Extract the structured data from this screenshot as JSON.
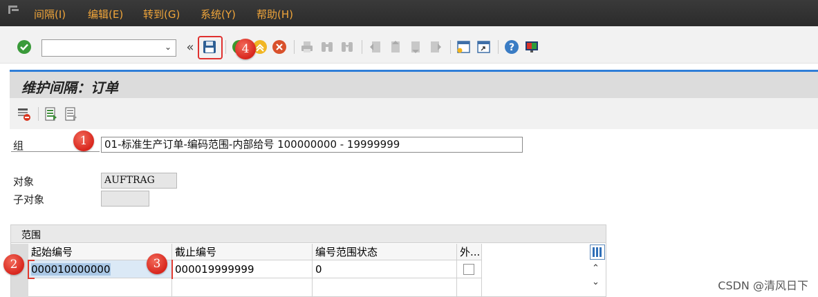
{
  "menubar": {
    "items": [
      "间隔(I)",
      "编辑(E)",
      "转到(G)",
      "系统(Y)",
      "帮助(H)"
    ]
  },
  "toolbar": {
    "command_value": "",
    "icons": [
      "enter-check-icon",
      "dropdown-icon",
      "double-left-icon",
      "save-icon",
      "back-icon",
      "exit-icon",
      "cancel-icon",
      "print-icon",
      "find-icon",
      "find-next-icon",
      "first-page-icon",
      "prev-page-icon",
      "next-page-icon",
      "last-page-icon",
      "new-session-icon",
      "shortcut-icon",
      "help-icon",
      "customize-layout-icon"
    ]
  },
  "title": "维护间隔：订单",
  "form": {
    "group_label": "组",
    "group_value": "01-标准生产订单-编码范围-内部给号 100000000 - 19999999",
    "object_label": "对象",
    "object_value": "AUFTRAG",
    "subobject_label": "子对象",
    "subobject_value": ""
  },
  "markers": [
    "1",
    "2",
    "3",
    "4"
  ],
  "range": {
    "section_label": "范围",
    "columns": [
      "起始编号",
      "截止编号",
      "编号范围状态",
      "外..."
    ],
    "rows": [
      {
        "from": "000010000000",
        "to": "000019999999",
        "status": "0",
        "external": false
      }
    ]
  },
  "watermark": "CSDN @清风日下",
  "colors": {
    "menu_text": "#f0a53a",
    "accent_blue": "#2f7ed8",
    "marker_red": "#d8261d"
  }
}
